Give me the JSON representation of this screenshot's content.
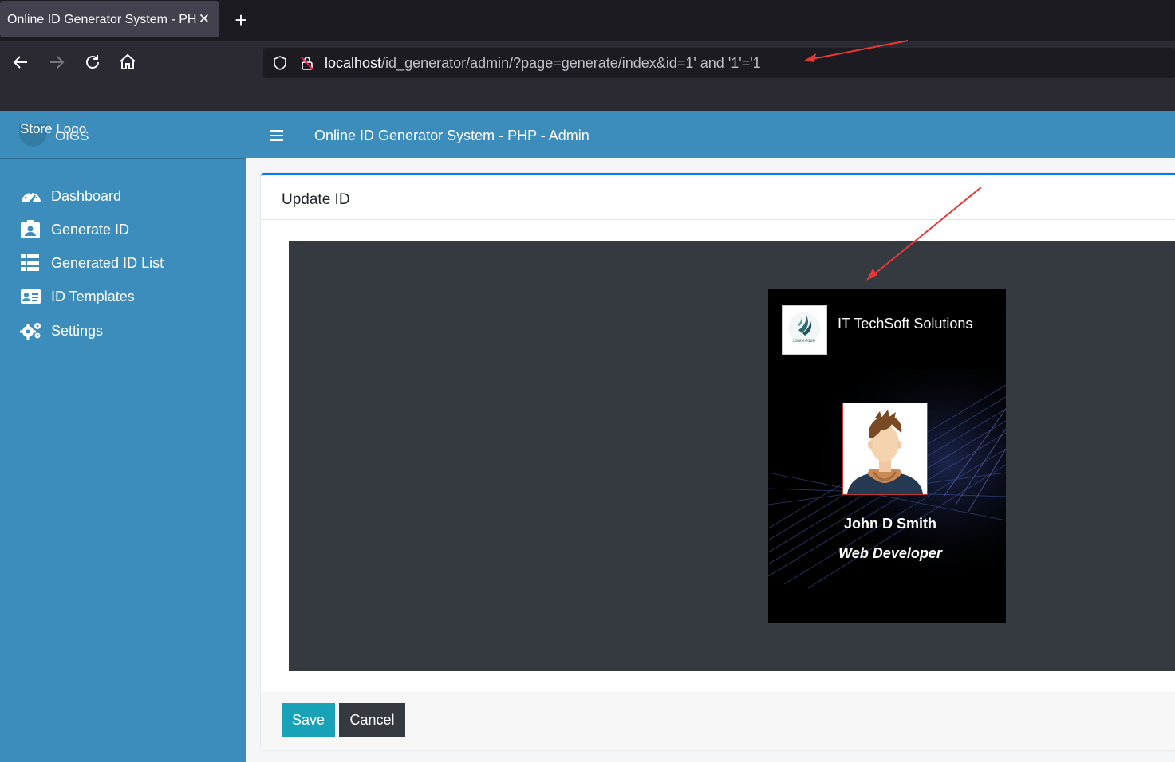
{
  "browser": {
    "tab_title": "Online ID Generator System - PHP - Admin",
    "url_host": "localhost",
    "url_path": "/id_generator/admin/?page=generate/index&id=1' and '1'='1"
  },
  "sidebar": {
    "store_logo": "Store Logo",
    "brand_text": "OIGS",
    "items": [
      {
        "label": "Dashboard",
        "icon": "dashboard-icon"
      },
      {
        "label": "Generate ID",
        "icon": "id-badge-icon"
      },
      {
        "label": "Generated ID List",
        "icon": "list-icon"
      },
      {
        "label": "ID Templates",
        "icon": "id-card-icon"
      },
      {
        "label": "Settings",
        "icon": "gears-icon"
      }
    ]
  },
  "header": {
    "title": "Online ID Generator System - PHP - Admin"
  },
  "card": {
    "title": "Update ID",
    "save_label": "Save",
    "cancel_label": "Cancel"
  },
  "id_card": {
    "company": "IT TechSoft Solutions",
    "logo_text": "LOREM IPSUM",
    "name": "John D Smith",
    "role": "Web Developer"
  },
  "colors": {
    "sidebar": "#3c8dbc",
    "save_button": "#17a2b8",
    "cancel_button": "#343a40",
    "preview_bg": "#343a40",
    "card_top_border": "#007bff",
    "annotation_arrow": "#e53935"
  }
}
